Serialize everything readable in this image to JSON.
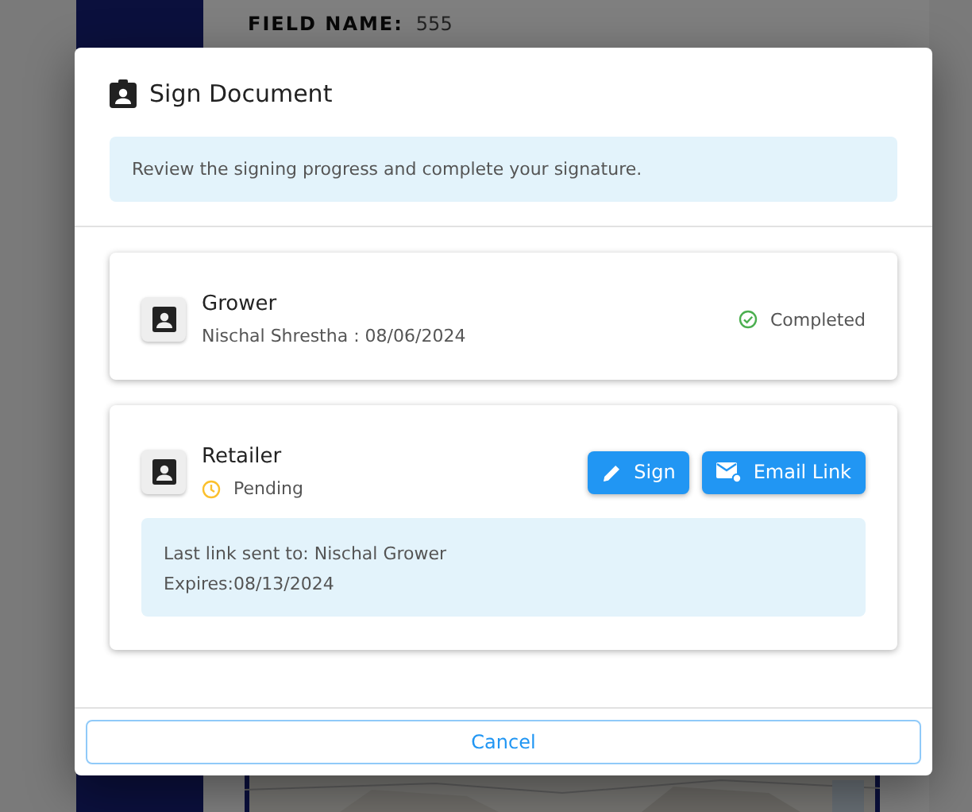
{
  "background": {
    "field": {
      "label": "FIELD NAME:",
      "value": "555"
    }
  },
  "dialog": {
    "title": "Sign Document",
    "info": "Review the signing progress and complete your signature.",
    "signers": [
      {
        "role": "Grower",
        "kind": "completed",
        "status_label": "Completed",
        "detail": "Nischal Shrestha : 08/06/2024"
      },
      {
        "role": "Retailer",
        "kind": "pending",
        "status_label": "Pending",
        "actions": [
          {
            "kind": "sign",
            "label": "Sign"
          },
          {
            "kind": "email",
            "label": "Email Link"
          }
        ],
        "note": [
          "Last link sent to: Nischal Grower",
          "Expires:08/13/2024"
        ]
      }
    ],
    "cancel": "Cancel"
  }
}
